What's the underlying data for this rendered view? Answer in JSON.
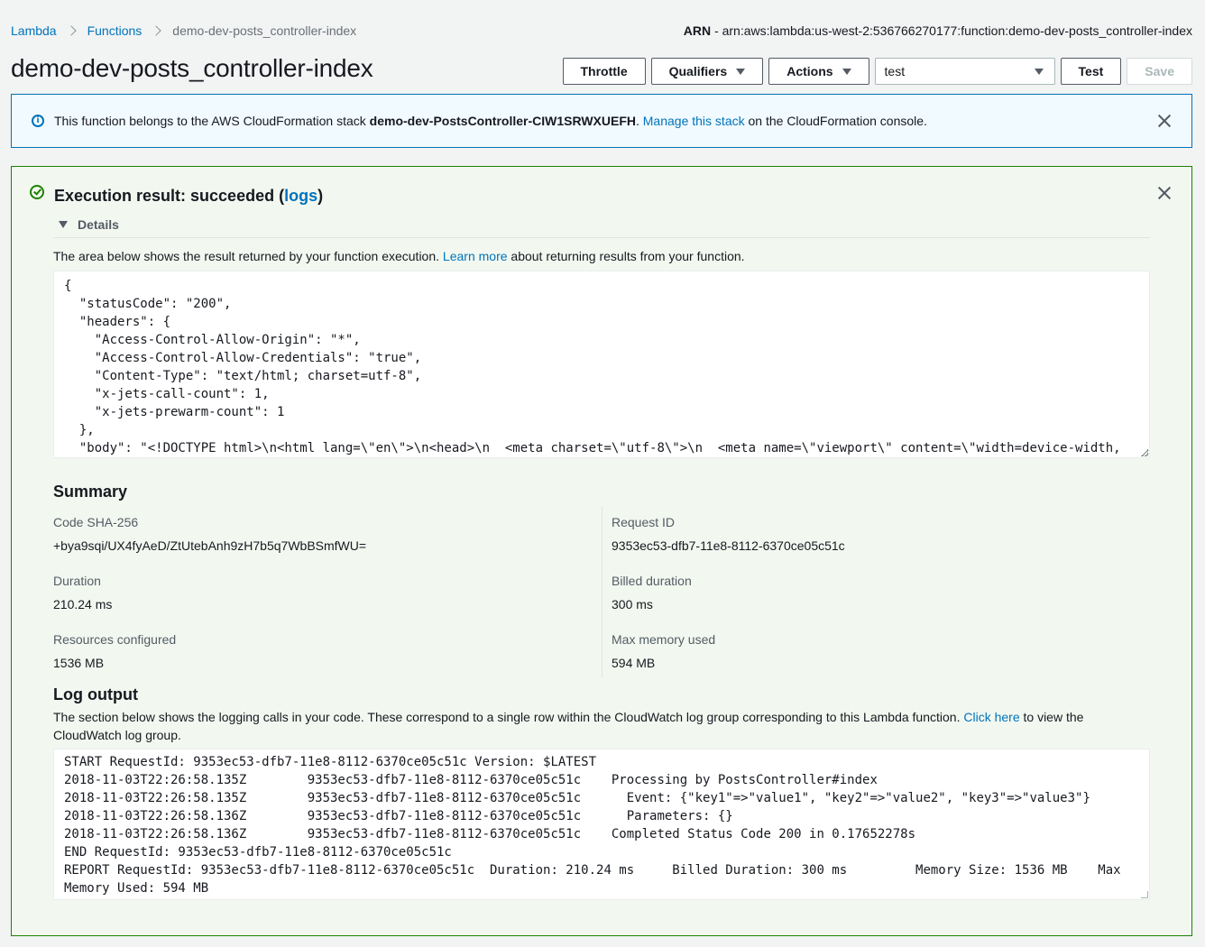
{
  "breadcrumb": {
    "items": [
      "Lambda",
      "Functions"
    ],
    "current": "demo-dev-posts_controller-index"
  },
  "arn": {
    "label": "ARN",
    "separator": " - ",
    "value": "arn:aws:lambda:us-west-2:536766270177:function:demo-dev-posts_controller-index"
  },
  "page_title": "demo-dev-posts_controller-index",
  "toolbar": {
    "throttle_label": "Throttle",
    "qualifiers_label": "Qualifiers",
    "actions_label": "Actions",
    "test_event_selected": "test",
    "test_label": "Test",
    "save_label": "Save"
  },
  "banner": {
    "prefix": "This function belongs to the AWS CloudFormation stack ",
    "stack": "demo-dev-PostsController-CIW1SRWXUEFH",
    "dot": ". ",
    "link": "Manage this stack",
    "suffix": " on the CloudFormation console."
  },
  "result": {
    "title_prefix": "Execution result: succeeded (",
    "logs_link": "logs",
    "title_suffix": ")",
    "details_label": "Details",
    "desc_prefix": "The area below shows the result returned by your function execution. ",
    "desc_link": "Learn more",
    "desc_suffix": " about returning results from your function.",
    "code": "{\n  \"statusCode\": \"200\",\n  \"headers\": {\n    \"Access-Control-Allow-Origin\": \"*\",\n    \"Access-Control-Allow-Credentials\": \"true\",\n    \"Content-Type\": \"text/html; charset=utf-8\",\n    \"x-jets-call-count\": 1,\n    \"x-jets-prewarm-count\": 1\n  },\n  \"body\": \"<!DOCTYPE html>\\n<html lang=\\\"en\\\">\\n<head>\\n  <meta charset=\\\"utf-8\\\">\\n  <meta name=\\\"viewport\\\" content=\\\"width=device-width,"
  },
  "summary": {
    "heading": "Summary",
    "code_sha_label": "Code SHA-256",
    "code_sha_value": "+bya9sqi/UX4fyAeD/ZtUtebAnh9zH7b5q7WbBSmfWU=",
    "request_id_label": "Request ID",
    "request_id_value": "9353ec53-dfb7-11e8-8112-6370ce05c51c",
    "duration_label": "Duration",
    "duration_value": "210.24 ms",
    "billed_label": "Billed duration",
    "billed_value": "300 ms",
    "resources_label": "Resources configured",
    "resources_value": "1536 MB",
    "max_mem_label": "Max memory used",
    "max_mem_value": "594 MB"
  },
  "log": {
    "heading": "Log output",
    "desc_prefix": "The section below shows the logging calls in your code. These correspond to a single row within the CloudWatch log group corresponding to this Lambda function. ",
    "desc_link": "Click here",
    "desc_suffix": " to view the CloudWatch log group.",
    "text": "START RequestId: 9353ec53-dfb7-11e8-8112-6370ce05c51c Version: $LATEST\n2018-11-03T22:26:58.135Z        9353ec53-dfb7-11e8-8112-6370ce05c51c    Processing by PostsController#index\n2018-11-03T22:26:58.135Z        9353ec53-dfb7-11e8-8112-6370ce05c51c      Event: {\"key1\"=>\"value1\", \"key2\"=>\"value2\", \"key3\"=>\"value3\"}\n2018-11-03T22:26:58.136Z        9353ec53-dfb7-11e8-8112-6370ce05c51c      Parameters: {}\n2018-11-03T22:26:58.136Z        9353ec53-dfb7-11e8-8112-6370ce05c51c    Completed Status Code 200 in 0.17652278s\nEND RequestId: 9353ec53-dfb7-11e8-8112-6370ce05c51c\nREPORT RequestId: 9353ec53-dfb7-11e8-8112-6370ce05c51c  Duration: 210.24 ms     Billed Duration: 300 ms         Memory Size: 1536 MB    Max\nMemory Used: 594 MB"
  },
  "colors": {
    "link": "#0073bb",
    "success": "#1d8102",
    "info_border": "#0073bb"
  }
}
